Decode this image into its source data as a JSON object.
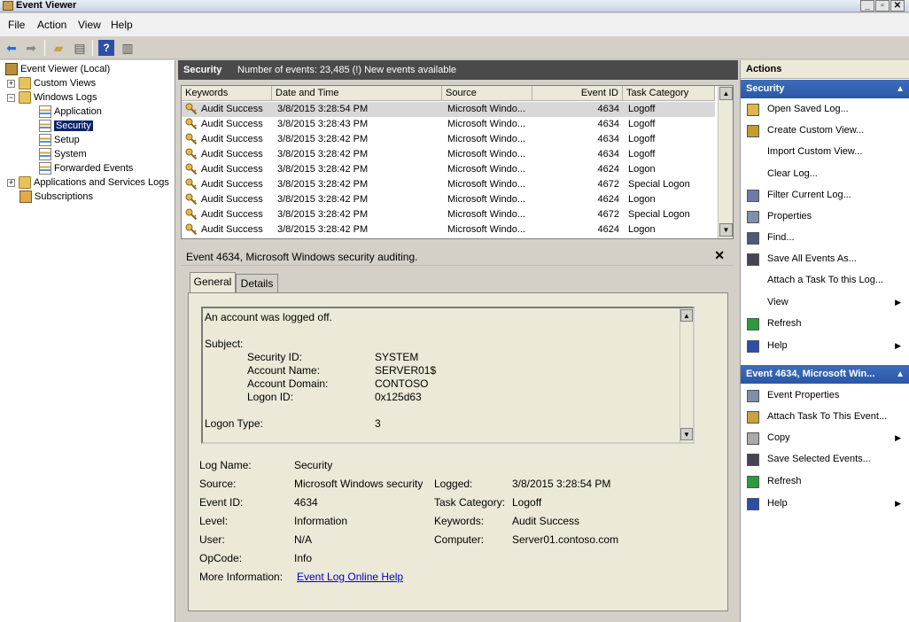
{
  "window": {
    "title": "Event Viewer"
  },
  "menu": [
    "File",
    "Action",
    "View",
    "Help"
  ],
  "tree": {
    "root": "Event Viewer (Local)",
    "custom_views": "Custom Views",
    "windows_logs": "Windows Logs",
    "logs": [
      "Application",
      "Security",
      "Setup",
      "System",
      "Forwarded Events"
    ],
    "apps_services": "Applications and Services Logs",
    "subscriptions": "Subscriptions"
  },
  "log_header": {
    "name": "Security",
    "info": "Number of events: 23,485 (!) New events available"
  },
  "grid": {
    "columns": [
      "Keywords",
      "Date and Time",
      "Source",
      "Event ID",
      "Task Category"
    ],
    "rows": [
      [
        "Audit Success",
        "3/8/2015 3:28:54 PM",
        "Microsoft Windo...",
        "4634",
        "Logoff"
      ],
      [
        "Audit Success",
        "3/8/2015 3:28:43 PM",
        "Microsoft Windo...",
        "4634",
        "Logoff"
      ],
      [
        "Audit Success",
        "3/8/2015 3:28:42 PM",
        "Microsoft Windo...",
        "4634",
        "Logoff"
      ],
      [
        "Audit Success",
        "3/8/2015 3:28:42 PM",
        "Microsoft Windo...",
        "4634",
        "Logoff"
      ],
      [
        "Audit Success",
        "3/8/2015 3:28:42 PM",
        "Microsoft Windo...",
        "4624",
        "Logon"
      ],
      [
        "Audit Success",
        "3/8/2015 3:28:42 PM",
        "Microsoft Windo...",
        "4672",
        "Special Logon"
      ],
      [
        "Audit Success",
        "3/8/2015 3:28:42 PM",
        "Microsoft Windo...",
        "4624",
        "Logon"
      ],
      [
        "Audit Success",
        "3/8/2015 3:28:42 PM",
        "Microsoft Windo...",
        "4672",
        "Special Logon"
      ],
      [
        "Audit Success",
        "3/8/2015 3:28:42 PM",
        "Microsoft Windo...",
        "4624",
        "Logon"
      ]
    ]
  },
  "event": {
    "title": "Event 4634, Microsoft Windows security auditing.",
    "close": "✕",
    "tabs": [
      "General",
      "Details"
    ],
    "description": {
      "line1": "An account was logged off.",
      "subject": "Subject:",
      "fields": [
        [
          "Security ID:",
          "SYSTEM"
        ],
        [
          "Account Name:",
          "SERVER01$"
        ],
        [
          "Account Domain:",
          "CONTOSO"
        ],
        [
          "Logon ID:",
          "0x125d63"
        ]
      ],
      "logon_type_label": "Logon Type:",
      "logon_type_value": "3"
    },
    "props": {
      "log_name_label": "Log Name:",
      "log_name": "Security",
      "source_label": "Source:",
      "source": "Microsoft Windows security",
      "logged_label": "Logged:",
      "logged": "3/8/2015 3:28:54 PM",
      "event_id_label": "Event ID:",
      "event_id": "4634",
      "task_cat_label": "Task Category:",
      "task_cat": "Logoff",
      "level_label": "Level:",
      "level": "Information",
      "keywords_label": "Keywords:",
      "keywords": "Audit Success",
      "user_label": "User:",
      "user": "N/A",
      "computer_label": "Computer:",
      "computer": "Server01.contoso.com",
      "opcode_label": "OpCode:",
      "opcode": "Info",
      "more_info_label": "More Information:",
      "more_info_link": "Event Log Online Help"
    }
  },
  "actions": {
    "header": "Actions",
    "section1": "Security",
    "items1": [
      "Open Saved Log...",
      "Create Custom View...",
      "Import Custom View...",
      "Clear Log...",
      "Filter Current Log...",
      "Properties",
      "Find...",
      "Save All Events As...",
      "Attach a Task To this Log...",
      "View",
      "Refresh",
      "Help"
    ],
    "section2": "Event 4634, Microsoft Win...",
    "items2": [
      "Event Properties",
      "Attach Task To This Event...",
      "Copy",
      "Save Selected Events...",
      "Refresh",
      "Help"
    ]
  },
  "colors": {
    "selection": "#0a246a",
    "section_header": "#2a57a6",
    "link": "#0000cc"
  }
}
